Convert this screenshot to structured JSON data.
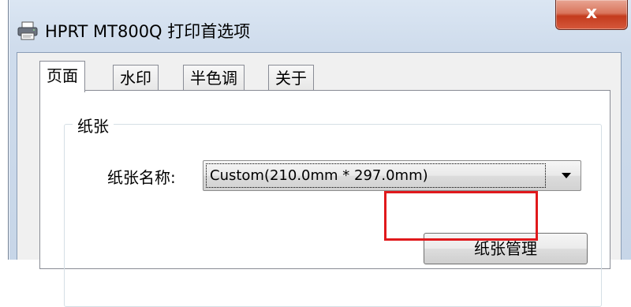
{
  "window": {
    "title": "HPRT MT800Q 打印首选项",
    "icon": "printer-icon",
    "close_symbol": "x",
    "colors": {
      "close_button": "#c9452b",
      "highlight": "#e0191c"
    }
  },
  "tabs": [
    {
      "label": "页面",
      "active": true
    },
    {
      "label": "水印",
      "active": false
    },
    {
      "label": "半色调",
      "active": false
    },
    {
      "label": "关于",
      "active": false
    }
  ],
  "paper_group": {
    "label": "纸张",
    "paper_name_label": "纸张名称:",
    "paper_name_value": "Custom(210.0mm * 297.0mm)",
    "manage_button": "纸张管理"
  }
}
